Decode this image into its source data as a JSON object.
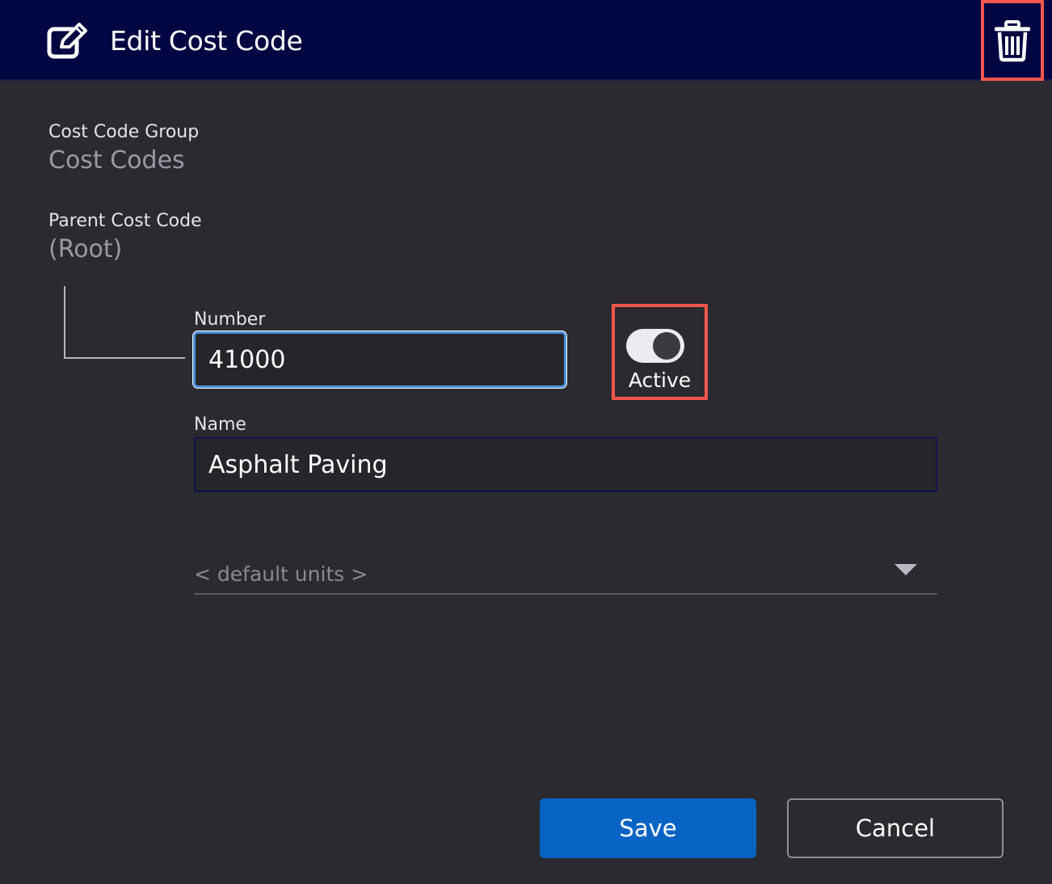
{
  "header": {
    "title": "Edit Cost Code",
    "edit_icon": "edit-icon",
    "delete_icon": "trash-icon"
  },
  "form": {
    "cost_code_group": {
      "label": "Cost Code Group",
      "value": "Cost Codes"
    },
    "parent_cost_code": {
      "label": "Parent Cost Code",
      "value": "(Root)"
    },
    "number": {
      "label": "Number",
      "value": "41000"
    },
    "active": {
      "label": "Active",
      "enabled": true
    },
    "name": {
      "label": "Name",
      "value": "Asphalt Paving"
    },
    "units": {
      "placeholder": "< default units >"
    }
  },
  "actions": {
    "save_label": "Save",
    "cancel_label": "Cancel"
  },
  "colors": {
    "header_bg": "#010541",
    "dialog_bg": "#2a2a30",
    "primary": "#0864c4",
    "highlight": "#f4574d"
  }
}
